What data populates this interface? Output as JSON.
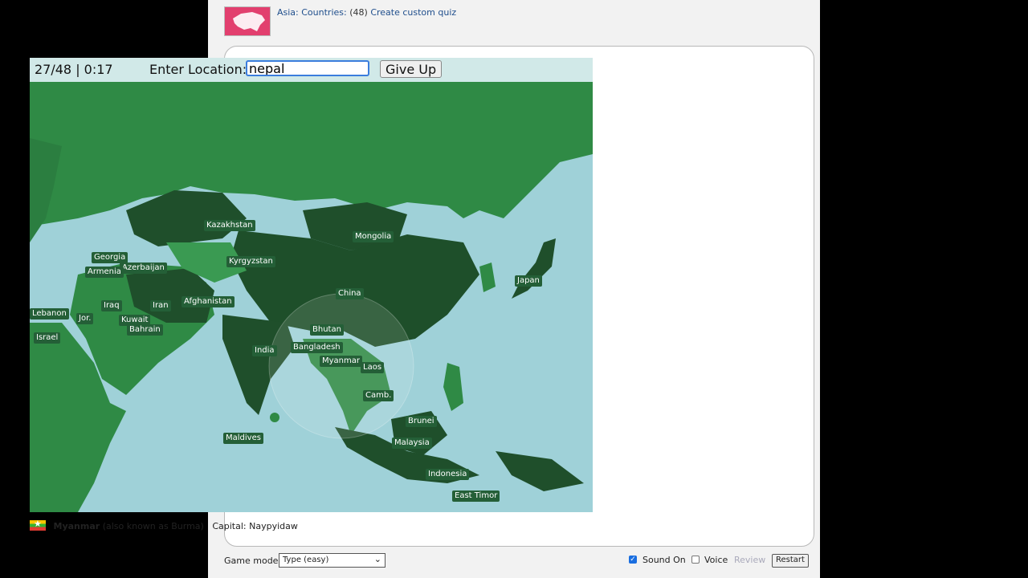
{
  "header": {
    "crumb_region": "Asia: Countries:",
    "crumb_count": "(48)",
    "crumb_custom": "Create custom quiz"
  },
  "quiz": {
    "score": "27/48 | 0:17",
    "enter_label": "Enter Location:",
    "input_value": "nepal",
    "give_up_label": "Give Up"
  },
  "map_labels": [
    "Kazakhstan",
    "Mongolia",
    "Georgia",
    "Azerbaijan",
    "Kyrgyzstan",
    "Armenia",
    "Japan",
    "China",
    "Iraq",
    "Iran",
    "Afghanistan",
    "Lebanon",
    "Jor.",
    "Kuwait",
    "Bahrain",
    "Bhutan",
    "Israel",
    "India",
    "Bangladesh",
    "Myanmar",
    "Laos",
    "Camb.",
    "Brunei",
    "Maldives",
    "Malaysia",
    "Indonesia",
    "East Timor"
  ],
  "info": {
    "country": "Myanmar",
    "aka": "(also known as Burma)",
    "capital": "Capital: Naypyidaw"
  },
  "controls": {
    "game_mode_label": "Game mode:",
    "game_mode_value": "Type (easy)",
    "sound_label": "Sound On",
    "sound_checked": true,
    "voice_label": "Voice",
    "voice_checked": false,
    "review_label": "Review",
    "restart_label": "Restart"
  },
  "colors": {
    "ocean": "#9fd1d8",
    "found_dark": "#1f5a2e",
    "found_mid": "#2e8a45",
    "land": "#2f8a45",
    "label_bg": "#245f37",
    "thumbnail": "#e23f6e"
  }
}
